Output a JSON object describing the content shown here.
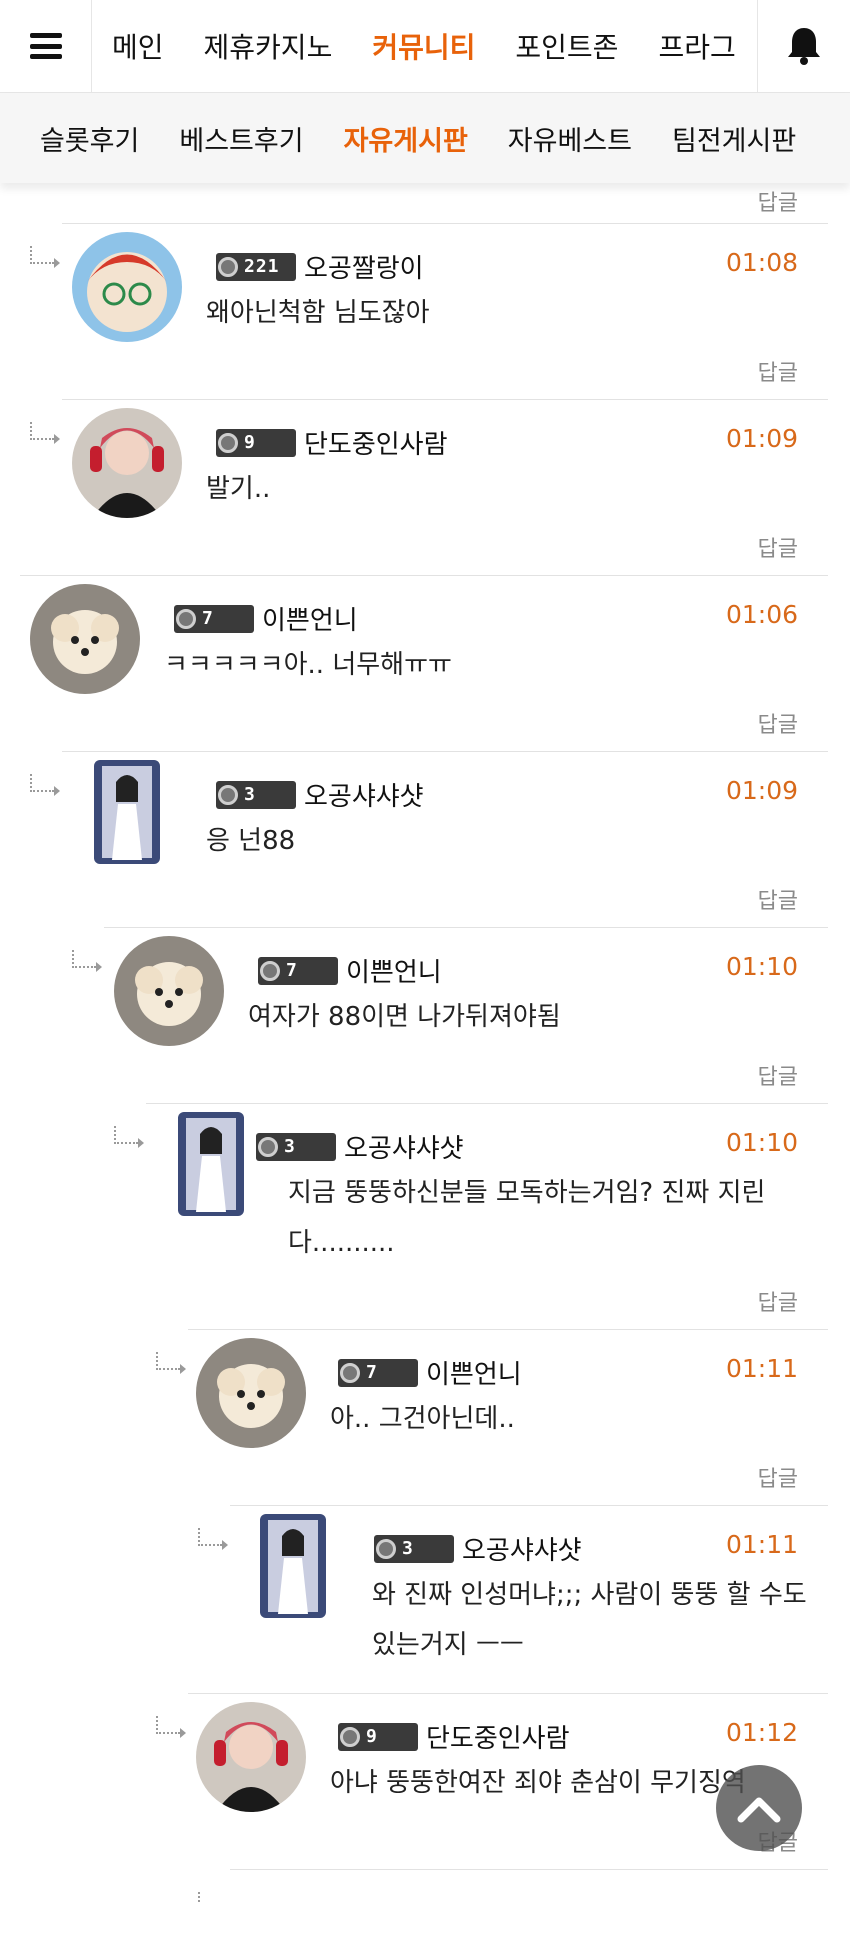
{
  "topnav": {
    "items": [
      "메인",
      "제휴카지노",
      "커뮤니티",
      "포인트존",
      "프라그"
    ],
    "active_index": 2
  },
  "subnav": {
    "items": [
      "슬롯후기",
      "베스트후기",
      "자유게시판",
      "자유베스트",
      "팀전게시판"
    ],
    "active_index": 2
  },
  "reply_label": "답글",
  "comments": [
    {
      "nickname": "오공짤랑이",
      "level": "221",
      "time": "01:08",
      "text": "왜아닌척함 님도잖아"
    },
    {
      "nickname": "단도중인사람",
      "level": "9",
      "time": "01:09",
      "text": "발기.."
    },
    {
      "nickname": "이쁜언니",
      "level": "7",
      "time": "01:06",
      "text": "ㅋㅋㅋㅋㅋ아.. 너무해ㅠㅠ"
    },
    {
      "nickname": "오공샤샤샷",
      "level": "3",
      "time": "01:09",
      "text": "응 넌88"
    },
    {
      "nickname": "이쁜언니",
      "level": "7",
      "time": "01:10",
      "text": "여자가 88이면 나가뒤져야됨"
    },
    {
      "nickname": "오공샤샤샷",
      "level": "3",
      "time": "01:10",
      "text": "지금 뚱뚱하신분들 모독하는거임? 진짜 지린다.........."
    },
    {
      "nickname": "이쁜언니",
      "level": "7",
      "time": "01:11",
      "text": "아.. 그건아닌데.."
    },
    {
      "nickname": "오공샤샤샷",
      "level": "3",
      "time": "01:11",
      "text": "와 진짜 인성머냐;;; 사람이 뚱뚱 할 수도 있는거지 ㅡㅡ"
    },
    {
      "nickname": "단도중인사람",
      "level": "9",
      "time": "01:12",
      "text": "아냐 뚱뚱한여잔 죄야 춘삼이 무기징역"
    }
  ],
  "colors": {
    "accent": "#e8620a",
    "time": "#d8691a"
  }
}
